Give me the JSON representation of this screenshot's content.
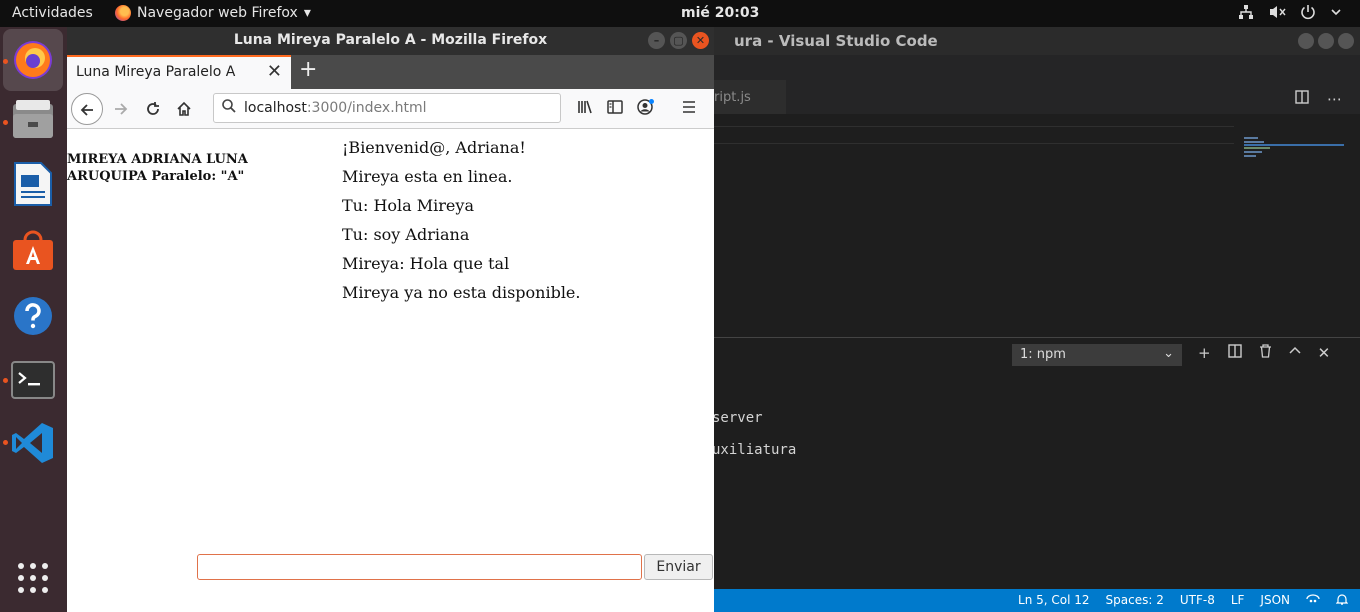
{
  "topbar": {
    "activities": "Actividades",
    "app_menu": "Navegador web Firefox",
    "app_menu_chevron": "▾",
    "clock": "mié 20:03",
    "tray_icons": [
      "network-icon",
      "volume-muted-icon",
      "power-icon",
      "chevron-down-icon"
    ]
  },
  "dock": {
    "items": [
      {
        "name": "firefox",
        "running": true,
        "active": true
      },
      {
        "name": "files",
        "running": true
      },
      {
        "name": "libreoffice-writer",
        "running": false
      },
      {
        "name": "ubuntu-software",
        "running": false
      },
      {
        "name": "help",
        "running": false
      },
      {
        "name": "terminal",
        "running": true
      },
      {
        "name": "vscode",
        "running": true
      },
      {
        "name": "show-applications",
        "running": false
      }
    ]
  },
  "vscode": {
    "title": "ura - Visual Studio Code",
    "tab_label": "ript.js",
    "terminal_select": "1: npm",
    "terminal_lines": [
      "server",
      "uxiliatura"
    ],
    "status": {
      "position": "Ln 5, Col 12",
      "spaces": "Spaces: 2",
      "encoding": "UTF-8",
      "eol": "LF",
      "language": "JSON"
    }
  },
  "firefox": {
    "window_title": "Luna Mireya Paralelo A - Mozilla Firefox",
    "tab_title": "Luna Mireya Paralelo A",
    "url_host": "localhost",
    "url_path": ":3000/index.html",
    "page": {
      "author": "MIREYA ADRIANA LUNA ARUQUIPA Paralelo: \"A\"",
      "messages": [
        "¡Bienvenid@, Adriana!",
        "Mireya esta en linea.",
        "Tu: Hola Mireya",
        "Tu: soy Adriana",
        "Mireya: Hola que tal",
        "Mireya ya no esta disponible."
      ],
      "input_value": "",
      "send_label": "Enviar"
    }
  },
  "colors": {
    "ubuntu_orange": "#e95420",
    "vscode_blue": "#007acc",
    "dock_bg": "#3b2a30"
  }
}
